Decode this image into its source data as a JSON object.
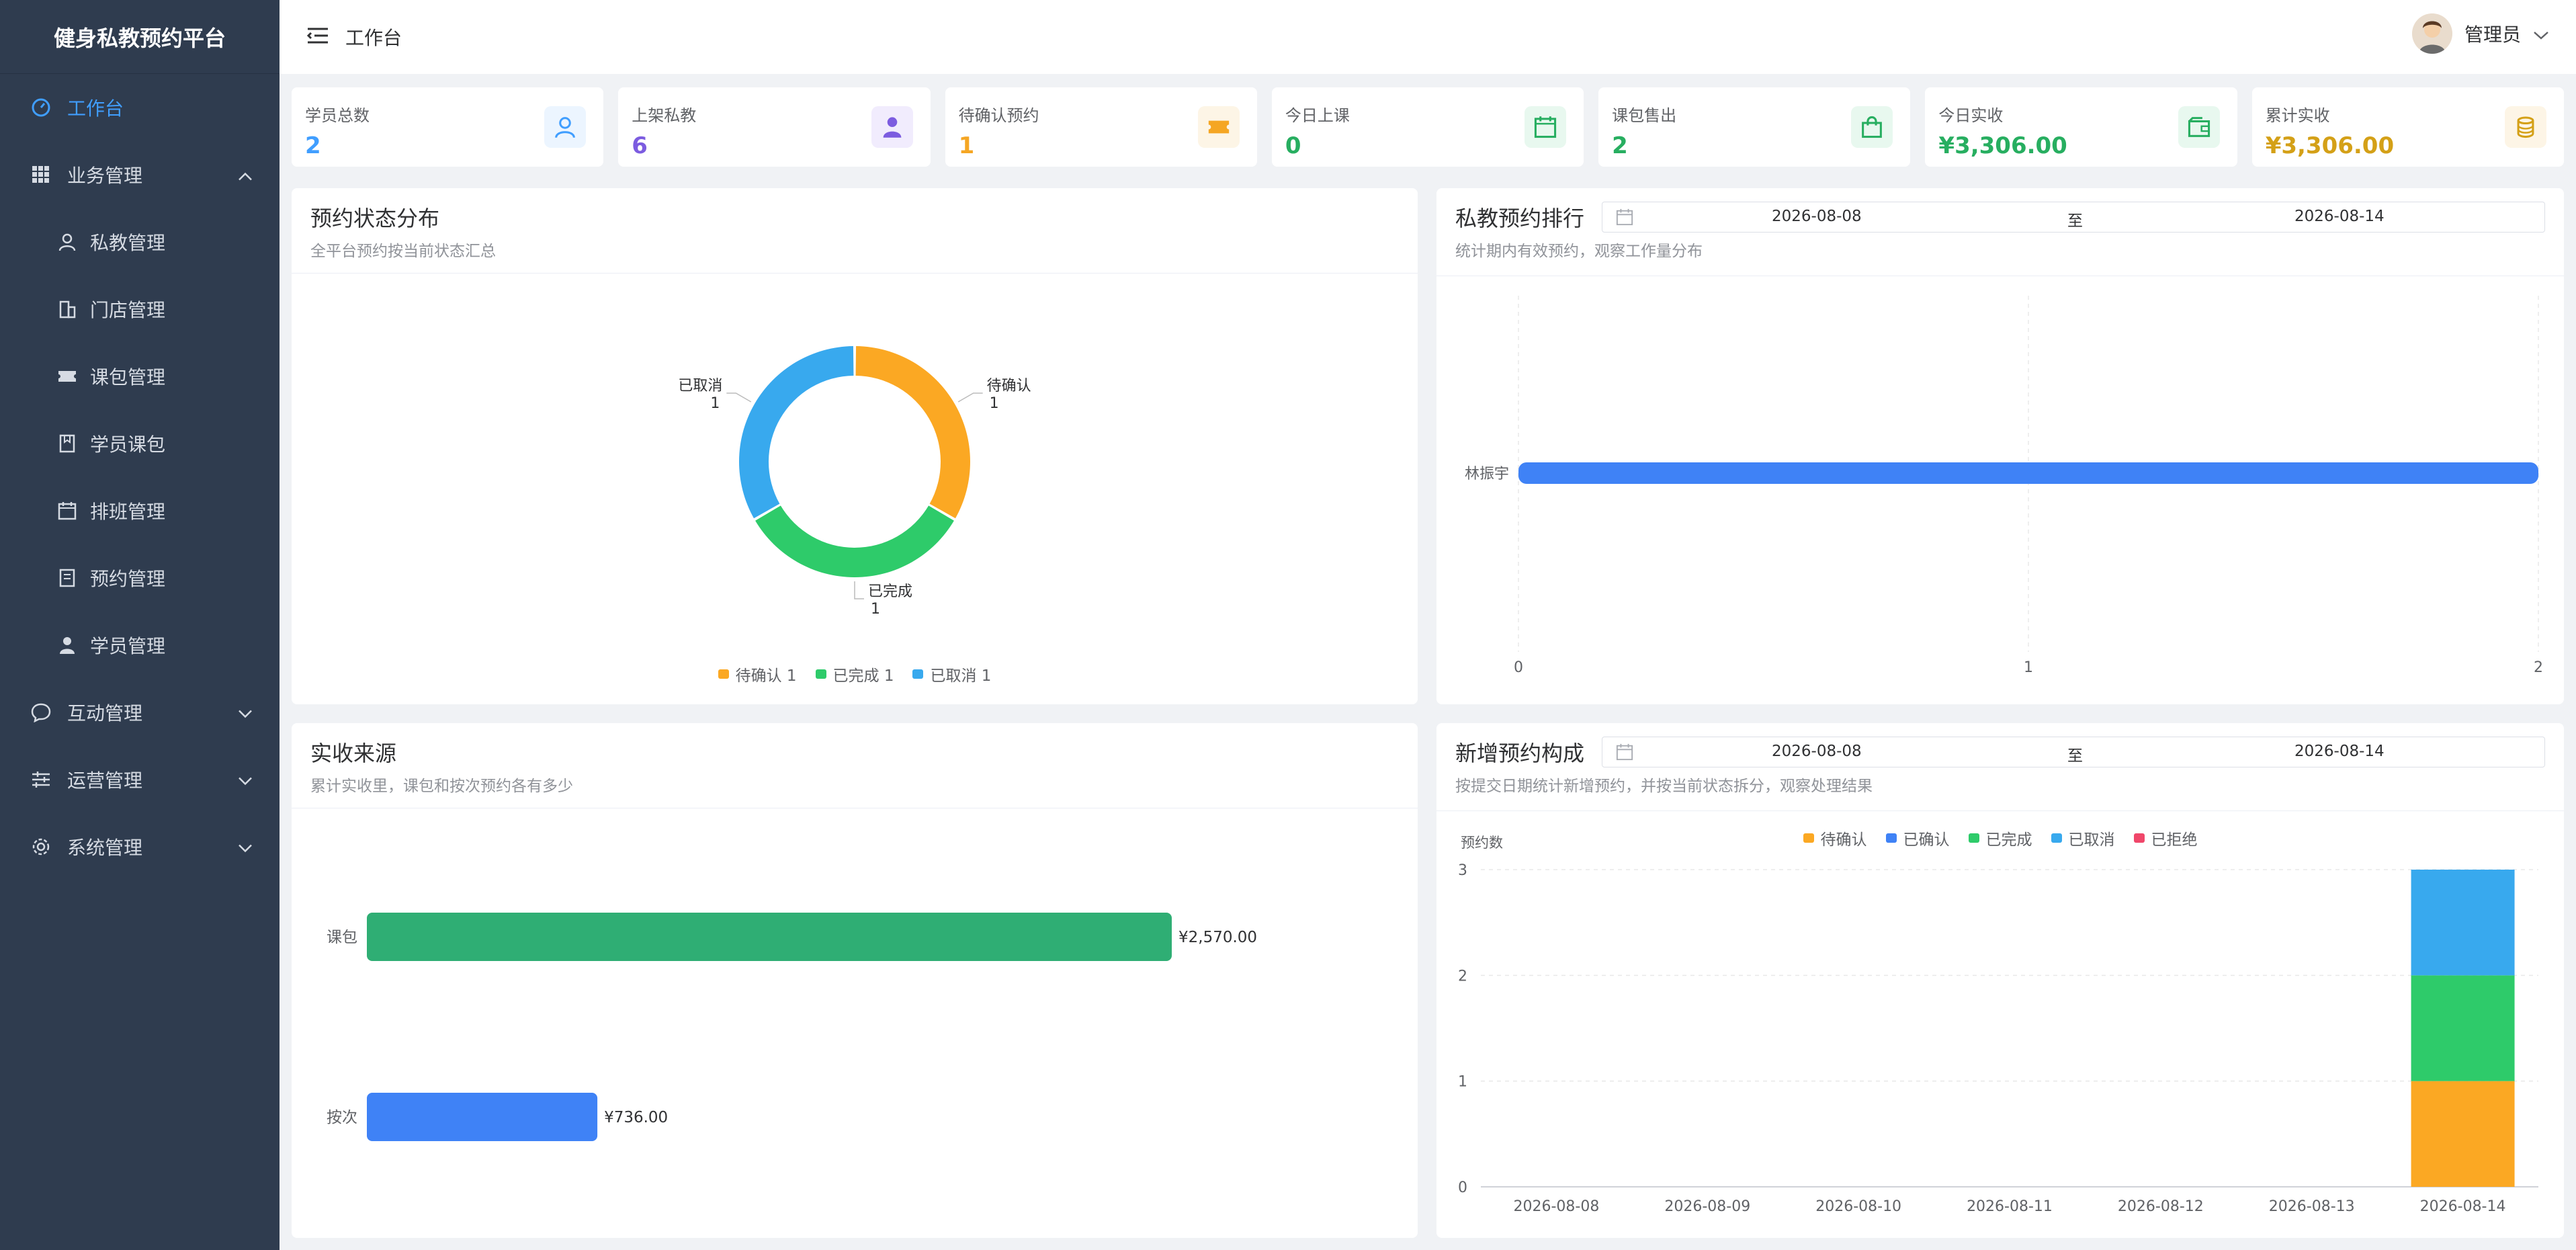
{
  "sidebar": {
    "brand": "健身私教预约平台",
    "items": [
      {
        "label": "工作台"
      },
      {
        "label": "业务管理"
      },
      {
        "label": "私教管理"
      },
      {
        "label": "门店管理"
      },
      {
        "label": "课包管理"
      },
      {
        "label": "学员课包"
      },
      {
        "label": "排班管理"
      },
      {
        "label": "预约管理"
      },
      {
        "label": "学员管理"
      },
      {
        "label": "互动管理"
      },
      {
        "label": "运营管理"
      },
      {
        "label": "系统管理"
      }
    ]
  },
  "header": {
    "breadcrumb": "工作台",
    "user_name": "管理员"
  },
  "stats": [
    {
      "label": "学员总数",
      "value": "2",
      "color": "#409eff"
    },
    {
      "label": "上架私教",
      "value": "6",
      "color": "#7c5ce0"
    },
    {
      "label": "待确认预约",
      "value": "1",
      "color": "#f5a623"
    },
    {
      "label": "今日上课",
      "value": "0",
      "color": "#27ae60"
    },
    {
      "label": "课包售出",
      "value": "2",
      "color": "#27ae60"
    },
    {
      "label": "今日实收",
      "value": "¥3,306.00",
      "color": "#27ae60"
    },
    {
      "label": "累计实收",
      "value": "¥3,306.00",
      "color": "#d4a017"
    }
  ],
  "panels": {
    "status": {
      "title": "预约状态分布",
      "subtitle": "全平台预约按当前状态汇总"
    },
    "ranking": {
      "title": "私教预约排行",
      "subtitle": "统计期内有效预约，观察工作量分布",
      "date_start": "2026-08-08",
      "date_sep": "至",
      "date_end": "2026-08-14"
    },
    "income": {
      "title": "实收来源",
      "subtitle": "累计实收里，课包和按次预约各有多少"
    },
    "newbook": {
      "title": "新增预约构成",
      "subtitle": "按提交日期统计新增预约，并按当前状态拆分，观察处理结果",
      "date_start": "2026-08-08",
      "date_sep": "至",
      "date_end": "2026-08-14"
    }
  },
  "chart_data": [
    {
      "type": "pie",
      "title": "预约状态分布",
      "labels": [
        "待确认",
        "已完成",
        "已取消"
      ],
      "values": [
        1,
        1,
        1
      ],
      "colors": [
        "#fba823",
        "#2ecb6a",
        "#38a9ee"
      ],
      "legend": "bottom",
      "legend_entries": [
        "待确认 1",
        "已完成 1",
        "已取消 1"
      ]
    },
    {
      "type": "bar",
      "title": "私教预约排行",
      "orientation": "horizontal",
      "categories": [
        "林振宇"
      ],
      "values": [
        2
      ],
      "xlim": [
        0,
        2
      ],
      "x_ticks": [
        "0",
        "1",
        "2"
      ],
      "color": "#3f82f6"
    },
    {
      "type": "bar",
      "title": "实收来源",
      "orientation": "horizontal",
      "categories": [
        "课包",
        "按次"
      ],
      "values": [
        2570.0,
        736.0
      ],
      "value_labels": [
        "¥2,570.00",
        "¥736.00"
      ],
      "colors": [
        "#2fae74",
        "#3f82f6"
      ]
    },
    {
      "type": "bar",
      "title": "新增预约构成",
      "stacked": true,
      "ylabel": "预约数",
      "categories": [
        "2026-08-08",
        "2026-08-09",
        "2026-08-10",
        "2026-08-11",
        "2026-08-12",
        "2026-08-13",
        "2026-08-14"
      ],
      "y_ticks": [
        "0",
        "1",
        "2",
        "3"
      ],
      "ylim": [
        0,
        3
      ],
      "legend": "top",
      "series": [
        {
          "name": "待确认",
          "values": [
            0,
            0,
            0,
            0,
            0,
            0,
            1
          ],
          "color": "#fba823"
        },
        {
          "name": "已确认",
          "values": [
            0,
            0,
            0,
            0,
            0,
            0,
            0
          ],
          "color": "#3f82f6"
        },
        {
          "name": "已完成",
          "values": [
            0,
            0,
            0,
            0,
            0,
            0,
            1
          ],
          "color": "#2ecb6a"
        },
        {
          "name": "已取消",
          "values": [
            0,
            0,
            0,
            0,
            0,
            0,
            1
          ],
          "color": "#38a9ee"
        },
        {
          "name": "已拒绝",
          "values": [
            0,
            0,
            0,
            0,
            0,
            0,
            0
          ],
          "color": "#f0476a"
        }
      ]
    }
  ]
}
